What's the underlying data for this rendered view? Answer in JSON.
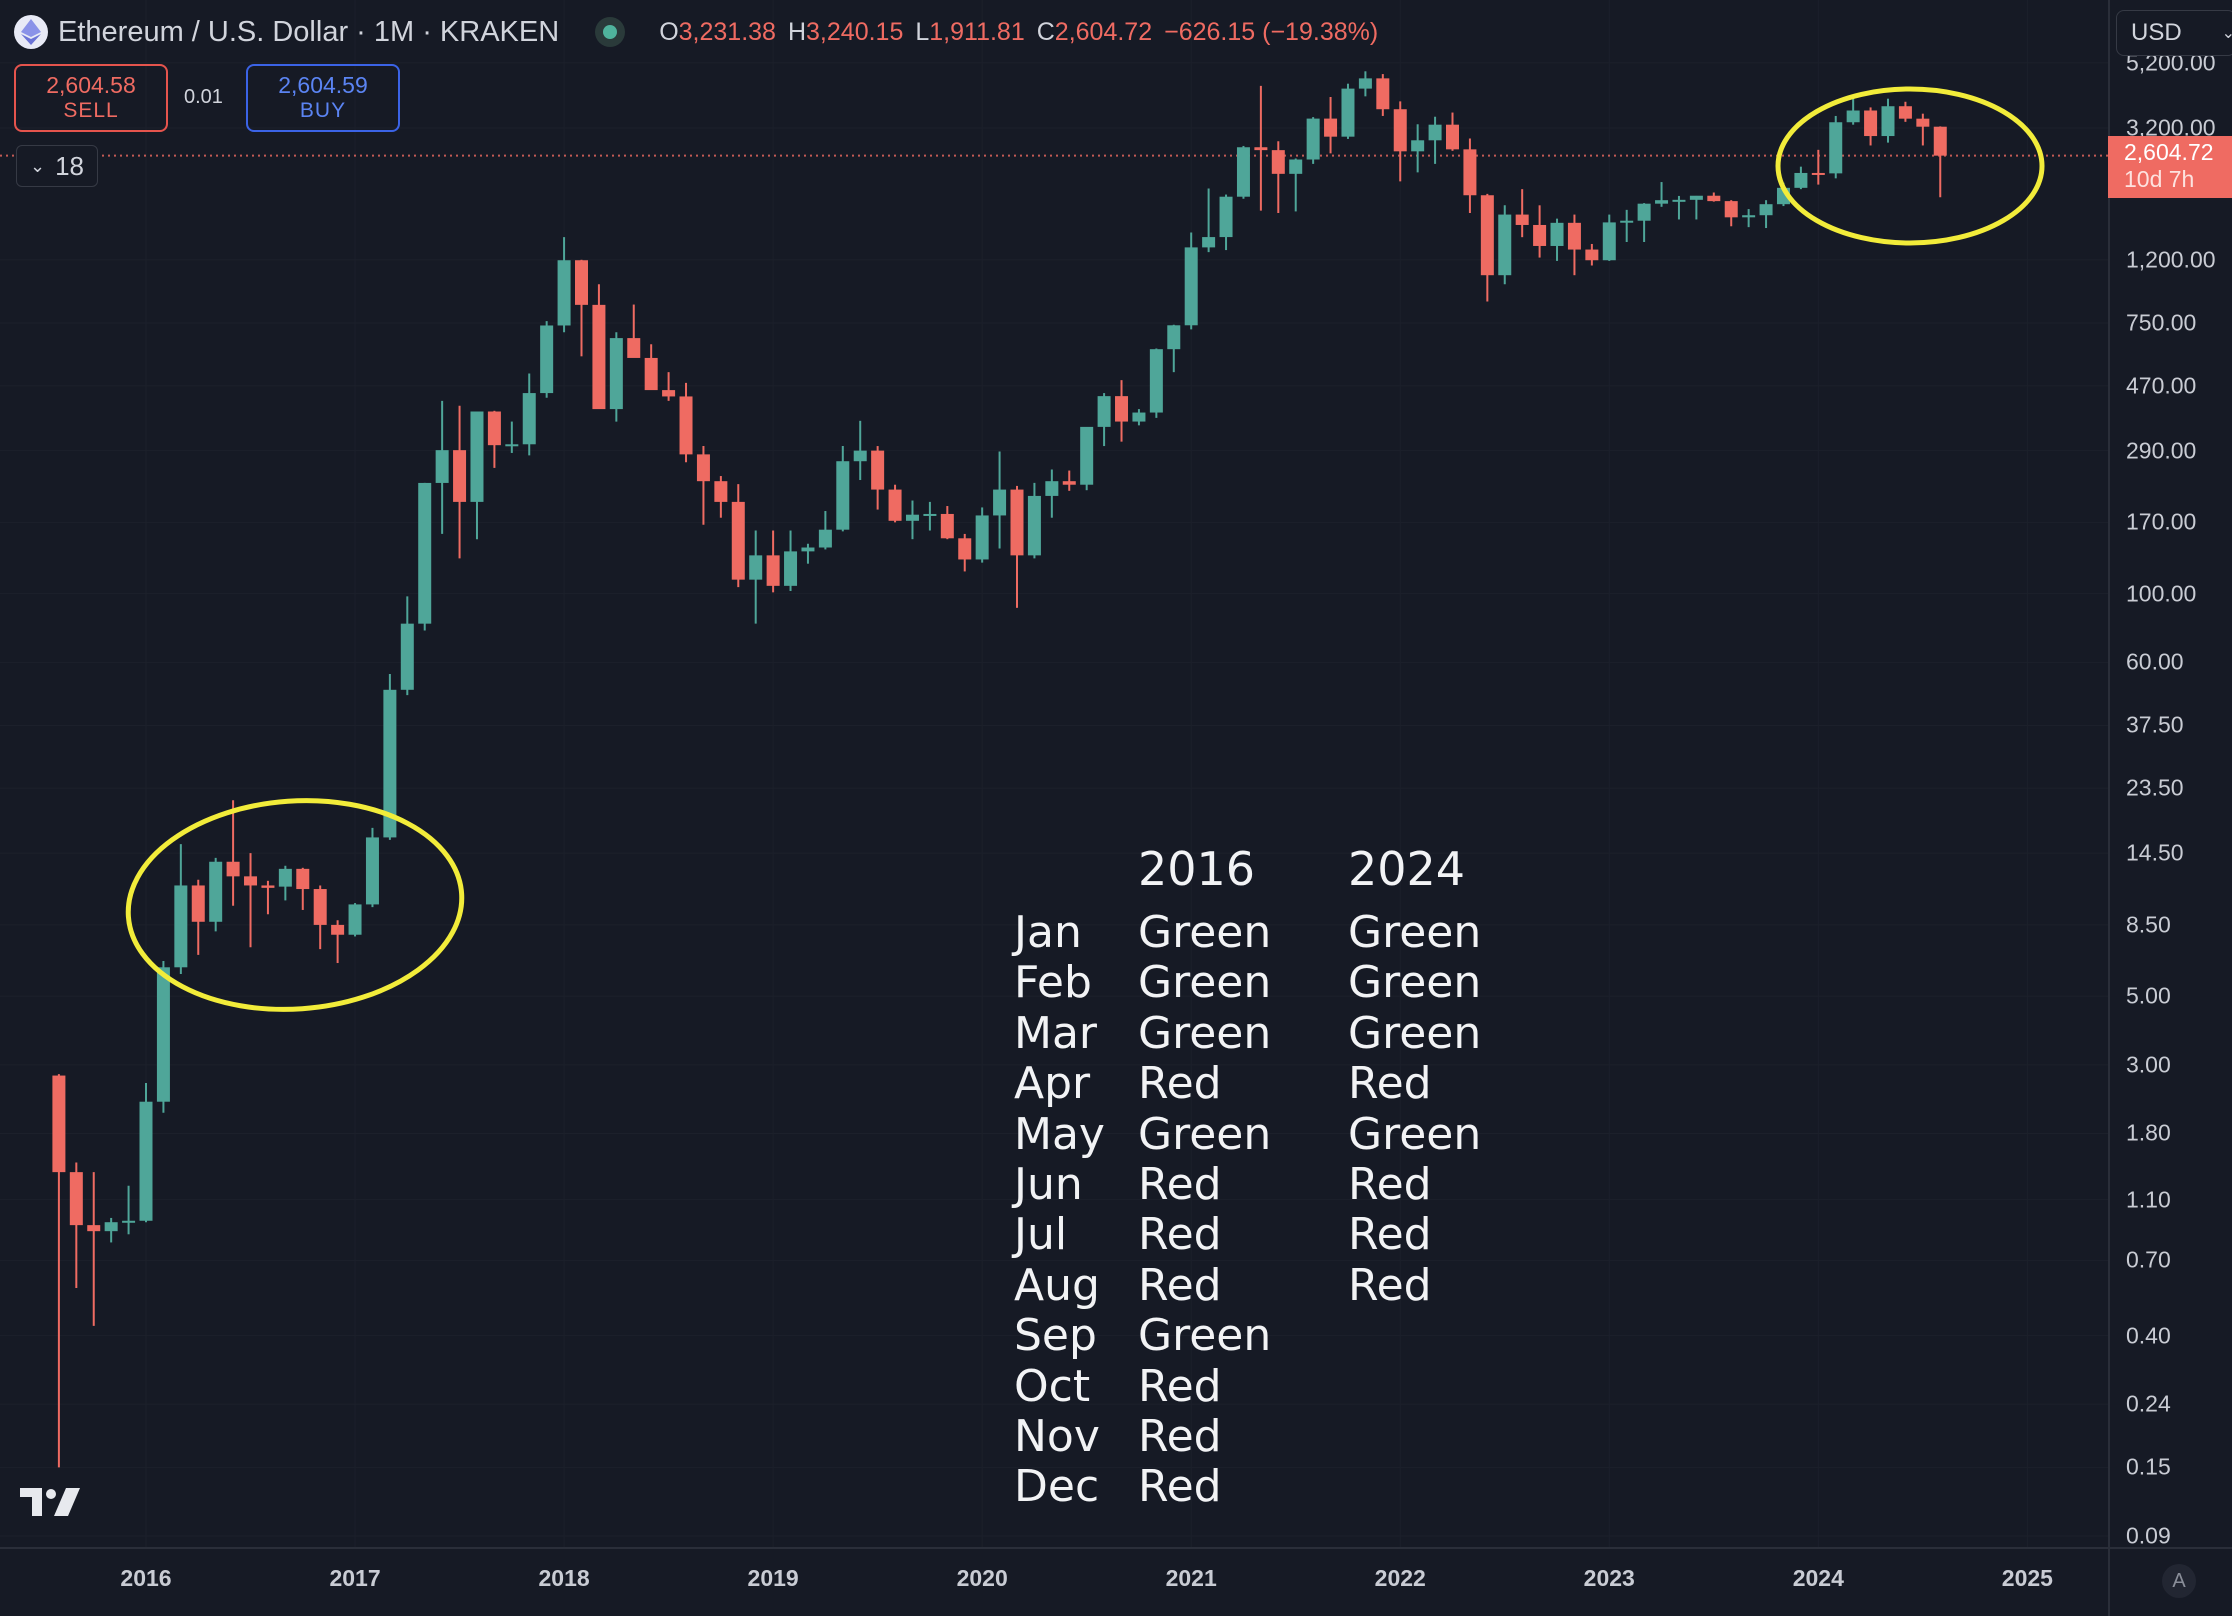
{
  "header": {
    "title": "Ethereum / U.S. Dollar · 1M · KRAKEN",
    "open_label": "O",
    "open": "3,231.38",
    "high_label": "H",
    "high": "3,240.15",
    "low_label": "L",
    "low": "1,911.81",
    "close_label": "C",
    "close": "2,604.72",
    "change": "−626.15 (−19.38%)"
  },
  "trade": {
    "sell_price": "2,604.58",
    "sell_label": "SELL",
    "spread": "0.01",
    "buy_price": "2,604.59",
    "buy_label": "BUY"
  },
  "indicator_toggle": {
    "count": "18"
  },
  "price_axis": {
    "currency": "USD",
    "current_price": "2,604.72",
    "countdown": "10d 7h"
  },
  "colors": {
    "up": "#4fa699",
    "down": "#ef6b62",
    "background": "#161a25",
    "annotation": "#f2ec3a"
  },
  "annotation_table": {
    "headers": [
      "",
      "2016",
      "2024"
    ],
    "rows": [
      [
        "Jan",
        "Green",
        "Green"
      ],
      [
        "Feb",
        "Green",
        "Green"
      ],
      [
        "Mar",
        "Green",
        "Green"
      ],
      [
        "Apr",
        "Red",
        "Red"
      ],
      [
        "May",
        "Green",
        "Green"
      ],
      [
        "Jun",
        "Red",
        "Red"
      ],
      [
        "Jul",
        "Red",
        "Red"
      ],
      [
        "Aug",
        "Red",
        "Red"
      ],
      [
        "Sep",
        "Green",
        ""
      ],
      [
        "Oct",
        "Red",
        ""
      ],
      [
        "Nov",
        "Red",
        ""
      ],
      [
        "Dec",
        "Red",
        ""
      ]
    ]
  },
  "chart_data": {
    "type": "candlestick",
    "title": "Ethereum / U.S. Dollar · 1M · KRAKEN",
    "scale": "log",
    "interval": "1M",
    "ylim": [
      0.09,
      5200
    ],
    "y_ticks": [
      "5,200.00",
      "3,200.00",
      "1,200.00",
      "750.00",
      "470.00",
      "290.00",
      "170.00",
      "100.00",
      "60.00",
      "37.50",
      "23.50",
      "14.50",
      "8.50",
      "5.00",
      "3.00",
      "1.80",
      "1.10",
      "0.70",
      "0.40",
      "0.24",
      "0.15",
      "0.09"
    ],
    "y_tick_values": [
      5200,
      3200,
      1200,
      750,
      470,
      290,
      170,
      100,
      60,
      37.5,
      23.5,
      14.5,
      8.5,
      5,
      3,
      1.8,
      1.1,
      0.7,
      0.4,
      0.24,
      0.15,
      0.09
    ],
    "x_ticks": [
      "2016",
      "2017",
      "2018",
      "2019",
      "2020",
      "2021",
      "2022",
      "2023",
      "2024",
      "2025"
    ],
    "start": "2015-08",
    "ohlc": [
      [
        2.77,
        2.8,
        0.15,
        1.35
      ],
      [
        1.35,
        1.45,
        0.57,
        0.91
      ],
      [
        0.91,
        1.35,
        0.43,
        0.87
      ],
      [
        0.87,
        0.96,
        0.8,
        0.93
      ],
      [
        0.93,
        1.22,
        0.85,
        0.94
      ],
      [
        0.94,
        2.62,
        0.93,
        2.28
      ],
      [
        2.28,
        6.5,
        2.1,
        6.2
      ],
      [
        6.2,
        15.5,
        5.9,
        11.4
      ],
      [
        11.4,
        11.9,
        6.8,
        8.7
      ],
      [
        8.7,
        14.0,
        8.1,
        13.6
      ],
      [
        13.6,
        21.5,
        9.8,
        12.2
      ],
      [
        12.2,
        14.5,
        7.2,
        11.4
      ],
      [
        11.4,
        11.8,
        9.2,
        11.2
      ],
      [
        11.3,
        13.2,
        10.2,
        12.9
      ],
      [
        12.9,
        13.0,
        9.5,
        11.1
      ],
      [
        11.1,
        11.4,
        7.1,
        8.5
      ],
      [
        8.5,
        8.8,
        6.4,
        7.9
      ],
      [
        7.9,
        10.0,
        7.8,
        9.9
      ],
      [
        9.9,
        17.5,
        9.7,
        16.3
      ],
      [
        16.3,
        55.0,
        16.0,
        48.9
      ],
      [
        48.9,
        98.0,
        47.0,
        80.0
      ],
      [
        80.0,
        228.0,
        76.0,
        228.0
      ],
      [
        228.0,
        420.0,
        156.0,
        291.0
      ],
      [
        291.0,
        405.0,
        130.0,
        198.0
      ],
      [
        198.0,
        340.0,
        150.0,
        388.0
      ],
      [
        388.0,
        390.0,
        255.0,
        302.0
      ],
      [
        302.0,
        360.0,
        285.0,
        304.0
      ],
      [
        304.0,
        515.0,
        280.0,
        445.0
      ],
      [
        445.0,
        760.0,
        430.0,
        736.0
      ],
      [
        736.0,
        1420.0,
        700.0,
        1196.0
      ],
      [
        1196.0,
        1200.0,
        585.0,
        858.0
      ],
      [
        858.0,
        1000.0,
        560.0,
        395.0
      ],
      [
        395.0,
        700.0,
        360.0,
        670.0
      ],
      [
        670.0,
        860.0,
        580.0,
        578.0
      ],
      [
        578.0,
        640.0,
        470.0,
        455.0
      ],
      [
        455.0,
        520.0,
        420.0,
        434.0
      ],
      [
        434.0,
        480.0,
        266.0,
        282.0
      ],
      [
        282.0,
        300.0,
        167.0,
        231.0
      ],
      [
        231.0,
        240.0,
        176.0,
        198.0
      ],
      [
        198.0,
        226.0,
        105.0,
        111.0
      ],
      [
        111.0,
        160.0,
        80.0,
        133.0
      ],
      [
        133.0,
        160.0,
        101.0,
        106.0
      ],
      [
        106.0,
        160.0,
        102.0,
        137.0
      ],
      [
        137.0,
        145.0,
        125.0,
        141.0
      ],
      [
        141.0,
        185.0,
        139.0,
        161.0
      ],
      [
        161.0,
        300.0,
        159.0,
        268.0
      ],
      [
        268.0,
        362.0,
        233.0,
        290.0
      ],
      [
        290.0,
        300.0,
        187.0,
        217.0
      ],
      [
        217.0,
        225.0,
        170.0,
        172.0
      ],
      [
        172.0,
        200.0,
        150.0,
        180.0
      ],
      [
        180.0,
        198.0,
        160.0,
        181.0
      ],
      [
        181.0,
        192.0,
        150.0,
        151.0
      ],
      [
        151.0,
        156.0,
        118.0,
        129.0
      ],
      [
        129.0,
        190.0,
        126.0,
        179.0
      ],
      [
        179.0,
        288.0,
        140.0,
        217.0
      ],
      [
        217.0,
        223.0,
        90.0,
        133.0
      ],
      [
        133.0,
        228.0,
        130.0,
        207.0
      ],
      [
        207.0,
        252.0,
        176.0,
        231.0
      ],
      [
        231.0,
        250.0,
        215.0,
        225.0
      ],
      [
        225.0,
        255.0,
        216.0,
        346.0
      ],
      [
        346.0,
        445.0,
        300.0,
        435.0
      ],
      [
        435.0,
        490.0,
        310.0,
        360.0
      ],
      [
        360.0,
        395.0,
        350.0,
        385.0
      ],
      [
        385.0,
        620.0,
        370.0,
        617.0
      ],
      [
        617.0,
        740.0,
        520.0,
        737.0
      ],
      [
        737.0,
        1470.0,
        715.0,
        1316.0
      ],
      [
        1316.0,
        2040.0,
        1270.0,
        1421.0
      ],
      [
        1421.0,
        1950.0,
        1290.0,
        1919.0
      ],
      [
        1919.0,
        2800.0,
        1890.0,
        2773.0
      ],
      [
        2773.0,
        4380.0,
        1730.0,
        2714.0
      ],
      [
        2714.0,
        2900.0,
        1700.0,
        2275.0
      ],
      [
        2275.0,
        2550.0,
        1720.0,
        2531.0
      ],
      [
        2531.0,
        3470.0,
        2450.0,
        3432.0
      ],
      [
        3432.0,
        4030.0,
        2650.0,
        3000.0
      ],
      [
        3000.0,
        4450.0,
        2950.0,
        4290.0
      ],
      [
        4290.0,
        4880.0,
        4050.0,
        4630.0
      ],
      [
        4630.0,
        4780.0,
        3500.0,
        3680.0
      ],
      [
        3680.0,
        3900.0,
        2150.0,
        2690.0
      ],
      [
        2690.0,
        3290.0,
        2300.0,
        2920.0
      ],
      [
        2920.0,
        3480.0,
        2450.0,
        3280.0
      ],
      [
        3280.0,
        3590.0,
        2700.0,
        2730.0
      ],
      [
        2730.0,
        2960.0,
        1700.0,
        1940.0
      ],
      [
        1940.0,
        1960.0,
        880.0,
        1070.0
      ],
      [
        1070.0,
        1800.0,
        1000.0,
        1680.0
      ],
      [
        1680.0,
        2030.0,
        1420.0,
        1555.0
      ],
      [
        1555.0,
        1800.0,
        1220.0,
        1330.0
      ],
      [
        1330.0,
        1630.0,
        1190.0,
        1580.0
      ],
      [
        1580.0,
        1680.0,
        1070.0,
        1295.0
      ],
      [
        1295.0,
        1350.0,
        1150.0,
        1196.0
      ],
      [
        1196.0,
        1680.0,
        1190.0,
        1585.0
      ],
      [
        1585.0,
        1740.0,
        1370.0,
        1605.0
      ],
      [
        1605.0,
        1830.0,
        1370.0,
        1822.0
      ],
      [
        1822.0,
        2140.0,
        1780.0,
        1870.0
      ],
      [
        1870.0,
        1930.0,
        1620.0,
        1875.0
      ],
      [
        1875.0,
        1930.0,
        1620.0,
        1933.0
      ],
      [
        1933.0,
        1980.0,
        1850.0,
        1857.0
      ],
      [
        1857.0,
        1870.0,
        1540.0,
        1646.0
      ],
      [
        1646.0,
        1750.0,
        1530.0,
        1672.0
      ],
      [
        1672.0,
        1870.0,
        1520.0,
        1815.0
      ],
      [
        1815.0,
        2130.0,
        1790.0,
        2050.0
      ],
      [
        2050.0,
        2400.0,
        2030.0,
        2290.0
      ],
      [
        2290.0,
        2720.0,
        2100.0,
        2283.0
      ],
      [
        2283.0,
        3500.0,
        2200.0,
        3340.0
      ],
      [
        3340.0,
        4090.0,
        3280.0,
        3645.0
      ],
      [
        3645.0,
        3730.0,
        2810.0,
        3014.0
      ],
      [
        3014.0,
        3980.0,
        2870.0,
        3763.0
      ],
      [
        3763.0,
        3890.0,
        3350.0,
        3430.0
      ],
      [
        3430.0,
        3560.0,
        2810.0,
        3231.0
      ],
      [
        3231.0,
        3240.15,
        1911.81,
        2604.72
      ]
    ]
  }
}
